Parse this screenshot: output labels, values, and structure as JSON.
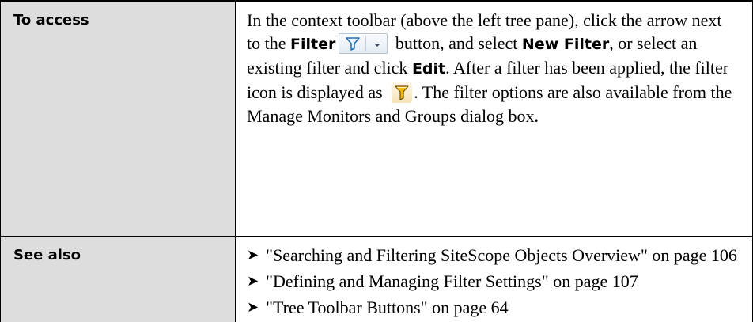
{
  "rows": [
    {
      "label": "To access",
      "content": {
        "t1": "In the context toolbar (above the left tree pane), click the arrow next to the ",
        "filter_label": "Filter",
        "t2": " button, and select ",
        "new_filter_label": "New Filter",
        "t3": ", or select an existing filter and click ",
        "edit_label": "Edit",
        "t4": ". After a filter has been applied, the filter icon is displayed as ",
        "t5": ". The filter options are also available from the Manage Monitors and Groups dialog box."
      },
      "icons": {
        "filter_button": "filter-icon",
        "filter_button_dropdown": "chevron-down-icon",
        "applied_filter": "filter-applied-icon"
      }
    },
    {
      "label": "See also",
      "links": [
        {
          "bullet": "➤",
          "text": "\"Searching and Filtering SiteScope Objects Overview\" on page 106"
        },
        {
          "bullet": "➤",
          "text": "\"Defining and Managing Filter Settings\" on page 107"
        },
        {
          "bullet": "➤",
          "text": "\"Tree Toolbar Buttons\" on page 64"
        }
      ]
    }
  ],
  "colors": {
    "label_background": "#dddddd",
    "border": "#000000",
    "filter_icon_blue": "#2a6fb4",
    "applied_icon_yellow": "#e8b400"
  }
}
